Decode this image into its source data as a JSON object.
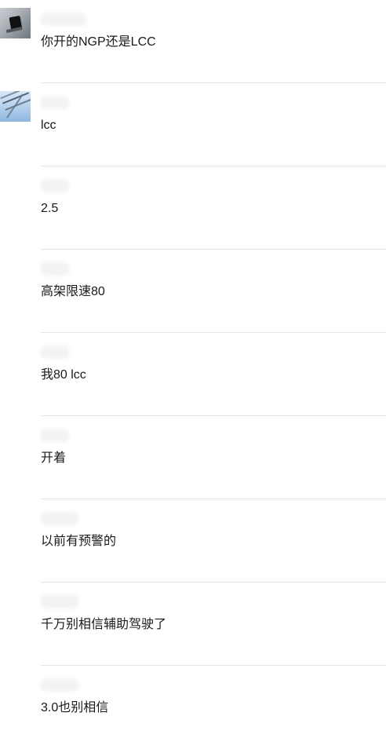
{
  "messages": [
    {
      "text": "你开的NGP还是LCC"
    },
    {
      "text": "lcc"
    },
    {
      "text": "2.5"
    },
    {
      "text": "高架限速80"
    },
    {
      "text": "我80 lcc"
    },
    {
      "text": "开着"
    },
    {
      "text": "以前有预警的"
    },
    {
      "text": "千万别相信辅助驾驶了"
    },
    {
      "text": "3.0也别相信"
    }
  ]
}
